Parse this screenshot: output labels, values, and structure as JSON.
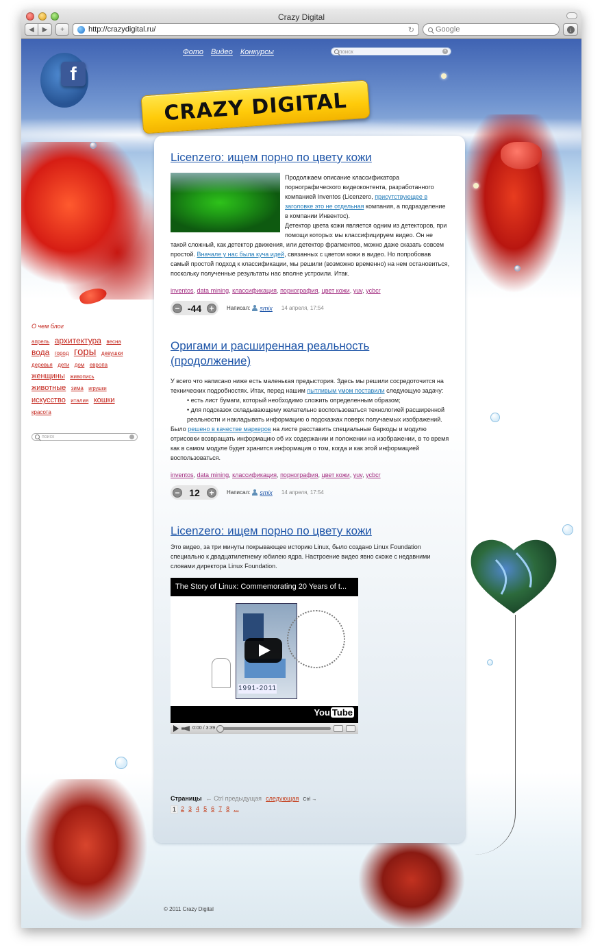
{
  "browser": {
    "window_title": "Crazy Digital",
    "url": "http://crazydigital.ru/",
    "search_placeholder": "Google"
  },
  "site": {
    "logo_text": "CRAZY DIGITAL",
    "nav": [
      "Фото",
      "Видео",
      "Конкурсы"
    ],
    "top_search_placeholder": "поиск",
    "footer": "© 2011 Crazy Digital"
  },
  "posts": [
    {
      "title": "Licenzero: ищем порно по цвету кожи",
      "body_intro": "Продолжаем описание классификатора порнографического видеоконтента, разработанного компанией Inventos (Licenzero, ",
      "link1": "присутствующее в заголовке это не отдельная",
      "body_after_link1": " компания, а подразделение в компании Инвентос).",
      "body_p2": "Детектор цвета кожи является одним из детекторов, при помощи которых мы классифицируем видео. Он не такой сложный, как детектор движения, или детектор фрагментов, можно даже сказать совсем простой. ",
      "link2": "Вначале у нас была куча идей",
      "body_after_link2": ", связанных с цветом кожи в видео. Но попробовав самый простой подход к классификации, мы решили (возможно временно) на нем остановиться, поскольку полученные результаты нас вполне устроили. Итак.",
      "tags": [
        "inventos",
        "data mining",
        "классификация",
        "порнография",
        "цвет кожи",
        "yuv",
        "ycbcr"
      ],
      "rating": "-44",
      "author_label": "Написал:",
      "author": "smix",
      "date": "14 апреля, 17:54"
    },
    {
      "title": "Оригами и расширенная реальность (продолжение)",
      "body_intro": "У всего что написано ниже есть маленькая предыстория. Здесь мы решили сосредоточится на технических подробностях. Итак, перед нашим ",
      "link1": "пытливым умом поставили",
      "body_after_link1": " следующую задачу:",
      "bullets": [
        "есть лист бумаги, который необходимо сложить определенным образом;",
        "для подсказок складывающему желательно воспользоваться технологией расширенной реальности и накладывать информацию о подсказках поверх получаемых изображений."
      ],
      "body_p2_prefix": "Было ",
      "link2": "решено в качестве маркеров",
      "body_p2_suffix": " на листе расставить специальные баркоды и модулю отрисовки возвращать информацию об их содержании и положении на изображении, в то время как в самом модуле будет хранится информация о том, когда и как этой информацией воспользоваться.",
      "tags": [
        "inventos",
        "data mining",
        "классификация",
        "порнография",
        "цвет кожи",
        "yuv",
        "ycbcr"
      ],
      "rating": "12",
      "author_label": "Написал:",
      "author": "smix",
      "date": "14 апреля, 17:54"
    },
    {
      "title": "Licenzero: ищем порно по цвету кожи",
      "body": "Это видео, за три минуты покрывающее историю Linux, было создано Linux Foundation специально к двадцатилетнему юбилею ядра. Настроение видео явно схоже с недавними словами директора Linux Foundation.",
      "video_title": "The Story of Linux: Commemorating 20 Years of t...",
      "video_years": "1991-2011",
      "video_brand_a": "You",
      "video_brand_b": "Tube",
      "video_time": "0:00 / 3:39"
    }
  ],
  "pagination": {
    "label": "Страницы",
    "prev": "← Ctrl предыдущая",
    "next": "следующая",
    "next_key": "Ctrl →",
    "pages": [
      "1",
      "2",
      "3",
      "4",
      "5",
      "6",
      "7",
      "8",
      "..."
    ]
  },
  "sidebar": {
    "heading": "О чем блог",
    "tags": [
      {
        "label": "апрель",
        "size": "s"
      },
      {
        "label": "архитектура",
        "size": "l"
      },
      {
        "label": "весна",
        "size": "s"
      },
      {
        "label": "вода",
        "size": "l"
      },
      {
        "label": "город",
        "size": "s"
      },
      {
        "label": "горы",
        "size": "xl"
      },
      {
        "label": "девушки",
        "size": "s"
      },
      {
        "label": "деревья",
        "size": "s"
      },
      {
        "label": "дети",
        "size": "s"
      },
      {
        "label": "дом",
        "size": "s"
      },
      {
        "label": "европа",
        "size": "s"
      },
      {
        "label": "женщины",
        "size": "m"
      },
      {
        "label": "живопись",
        "size": "s"
      },
      {
        "label": "животные",
        "size": "m"
      },
      {
        "label": "зима",
        "size": "s"
      },
      {
        "label": "игрушки",
        "size": "xs"
      },
      {
        "label": "искусство",
        "size": "m"
      },
      {
        "label": "италия",
        "size": "s"
      },
      {
        "label": "кошки",
        "size": "m"
      },
      {
        "label": "красота",
        "size": "s"
      }
    ],
    "search_placeholder": "поиск"
  },
  "colors": {
    "link_blue": "#1e55a8",
    "tag_purple": "#a0287d",
    "cloud_red": "#c3241b",
    "logo_yellow": "#ffd21f"
  }
}
